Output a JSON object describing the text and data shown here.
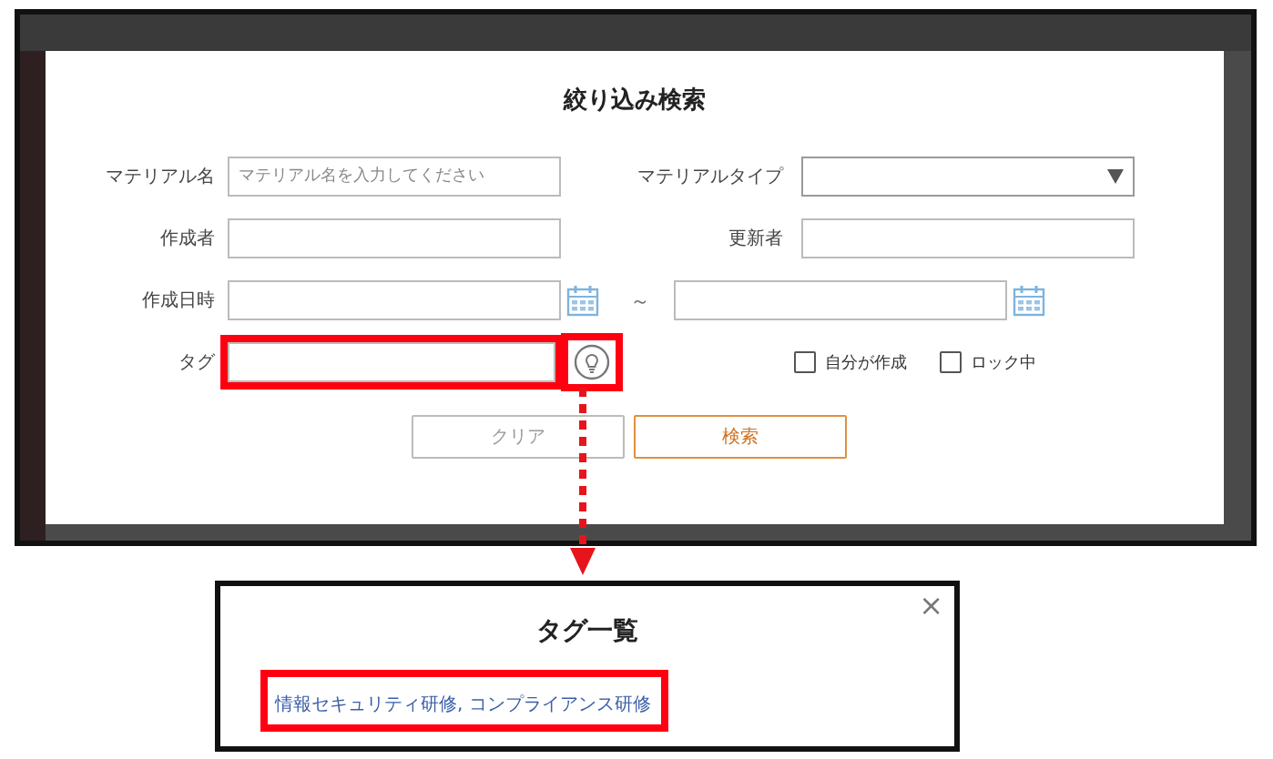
{
  "dialog": {
    "title": "絞り込み検索",
    "rows": [
      {
        "items": [
          {
            "kind": "text",
            "label": "マテリアル名",
            "placeholder": "マテリアル名を入力してください"
          },
          {
            "kind": "select",
            "label": "マテリアルタイプ"
          }
        ]
      },
      {
        "items": [
          {
            "kind": "text",
            "label": "作成者"
          },
          {
            "kind": "text",
            "label": "更新者"
          }
        ]
      },
      {
        "items": [
          {
            "kind": "daterange",
            "label": "作成日時",
            "separator": "～"
          }
        ]
      },
      {
        "items": [
          {
            "kind": "tag",
            "label": "タグ"
          },
          {
            "kind": "checkboxes",
            "options": [
              {
                "label": "自分が作成",
                "checked": false
              },
              {
                "label": "ロック中",
                "checked": false
              }
            ]
          }
        ]
      }
    ],
    "buttons": [
      {
        "label": "クリア",
        "kind": "secondary"
      },
      {
        "label": "検索",
        "kind": "primary"
      }
    ]
  },
  "tag_popup": {
    "title": "タグ一覧",
    "close": "×",
    "tags": "情報セキュリティ研修, コンプライアンス研修"
  }
}
